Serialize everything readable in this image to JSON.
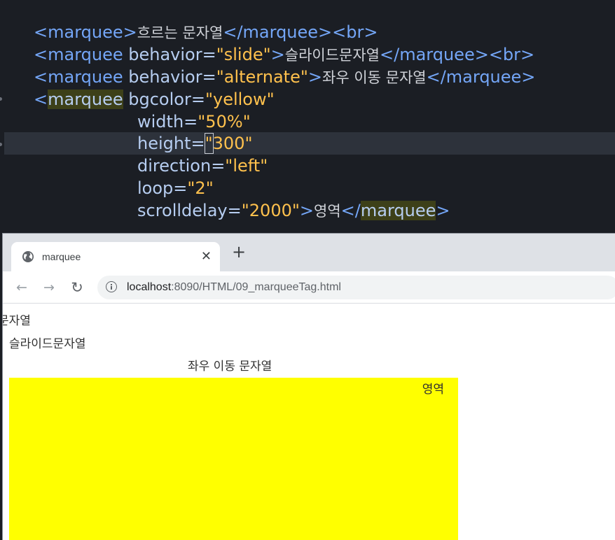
{
  "editor": {
    "line1": {
      "open_tag": "<marquee>",
      "text": "흐르는 문자열",
      "close_tag": "</marquee><br>"
    },
    "line2": {
      "tag_open": "<marquee",
      "attr": "behavior",
      "eq": "=",
      "value": "\"slide\"",
      "tag_end": ">",
      "text": "슬라이드문자열",
      "close_tag": "</marquee><br>"
    },
    "line3": {
      "tag_open": "<marquee",
      "attr": "behavior",
      "eq": "=",
      "value": "\"alternate\"",
      "tag_end": ">",
      "text": "좌우 이동 문자열",
      "close_tag": "</marquee>"
    },
    "line4": {
      "lt": "<",
      "tag_name": "marquee",
      "attr": "bgcolor",
      "eq": "=",
      "value": "\"yellow\""
    },
    "line5": {
      "attr": "width",
      "eq": "=",
      "value": "\"50%\""
    },
    "line6": {
      "attr": "height",
      "eq": "=",
      "cursor_char": "\"",
      "value_rest": "300\""
    },
    "line7": {
      "attr": "direction",
      "eq": "=",
      "value": "\"left\""
    },
    "line8": {
      "attr": "loop",
      "eq": "=",
      "value": "\"2\""
    },
    "line9": {
      "attr": "scrolldelay",
      "eq": "=",
      "value": "\"2000\"",
      "tag_end": ">",
      "text": "영역",
      "close_lt": "</",
      "close_name": "marquee",
      "close_gt": ">"
    }
  },
  "browser": {
    "tab_title": "marquee",
    "tab_close": "✕",
    "new_tab": "+",
    "back_icon": "←",
    "forward_icon": "→",
    "reload_icon": "↻",
    "url_host": "localhost",
    "url_rest": ":8090/HTML/09_marqueeTag.html"
  },
  "page": {
    "marquee1": "문자열",
    "marquee2": "슬라이드문자열",
    "marquee3": "좌우 이동 문자열",
    "marquee4": "영역",
    "marquee4_bgcolor": "#ffff00"
  }
}
